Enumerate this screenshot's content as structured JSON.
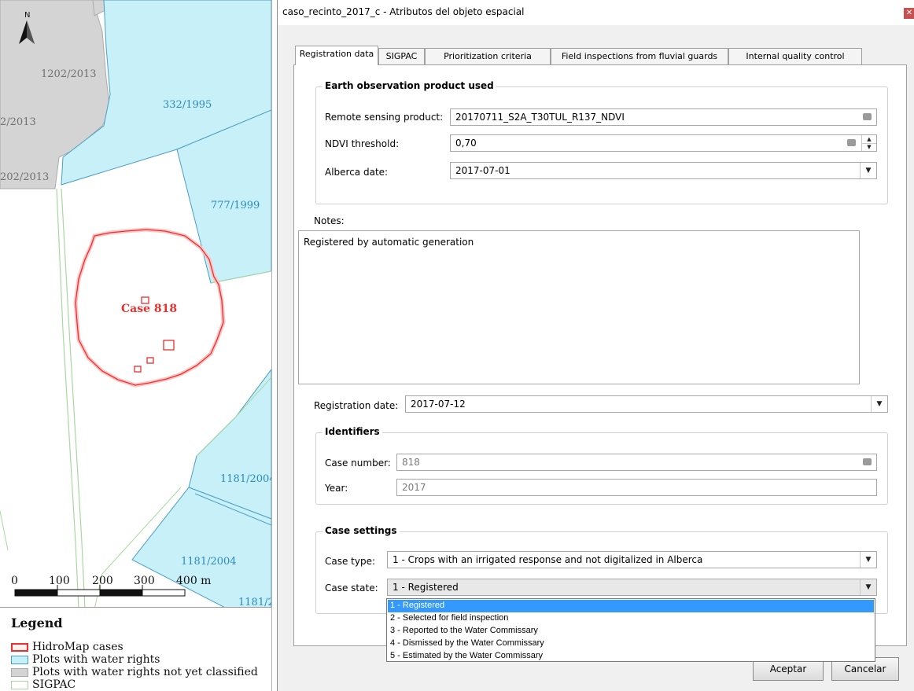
{
  "map": {
    "north_label": "N",
    "parcels": [
      {
        "label": "1202/2013",
        "kind": "not-classified"
      },
      {
        "label": "2/2013",
        "kind": "not-classified"
      },
      {
        "label": "202/2013",
        "kind": "not-classified"
      },
      {
        "label": "332/1995",
        "kind": "water-rights"
      },
      {
        "label": "777/1999",
        "kind": "water-rights"
      },
      {
        "label": "1181/2004",
        "kind": "water-rights"
      },
      {
        "label": "1181/2004",
        "kind": "water-rights"
      },
      {
        "label": "1181/2",
        "kind": "water-rights"
      }
    ],
    "case_label": "Case 818",
    "scale": {
      "ticks": [
        "0",
        "100",
        "200",
        "300",
        "400 m"
      ]
    },
    "legend": {
      "title": "Legend",
      "items": [
        {
          "label": "HidroMap cases",
          "color": "#e8312f"
        },
        {
          "label": "Plots with water rights",
          "color": "#c8f0f8"
        },
        {
          "label": "Plots with water rights not yet classified",
          "color": "#d4d4d4"
        },
        {
          "label": "SIGPAC",
          "color": "#a8d8a0"
        }
      ]
    }
  },
  "dialog": {
    "title": "caso_recinto_2017_c - Atributos del objeto espacial",
    "tabs": [
      "Registration data",
      "SIGPAC",
      "Prioritization criteria",
      "Field inspections from fluvial guards",
      "Internal quality control"
    ],
    "active_tab": "Registration data",
    "earth_observation": {
      "title": "Earth observation product used",
      "remote_sensing_label": "Remote sensing product:",
      "remote_sensing_value": "20170711_S2A_T30TUL_R137_NDVI",
      "ndvi_label": "NDVI threshold:",
      "ndvi_value": "0,70",
      "alberca_label": "Alberca date:",
      "alberca_value": "2017-07-01"
    },
    "notes_label": "Notes:",
    "notes_value": "Registered by automatic generation",
    "registration_date_label": "Registration date:",
    "registration_date_value": "2017-07-12",
    "identifiers": {
      "title": "Identifiers",
      "case_number_label": "Case number:",
      "case_number_value": "818",
      "year_label": "Year:",
      "year_value": "2017"
    },
    "case_settings": {
      "title": "Case settings",
      "type_label": "Case type:",
      "type_value": "1 - Crops with an irrigated response and not digitalized in Alberca",
      "state_label": "Case state:",
      "state_value": "1 - Registered",
      "state_options": [
        "1 - Registered",
        "2 - Selected for field inspection",
        "3 - Reported to the Water Commissary",
        "4 - Dismissed by the Water Commissary",
        "5 - Estimated by the Water Commissary"
      ]
    },
    "buttons": {
      "ok": "Aceptar",
      "cancel": "Cancelar"
    }
  }
}
